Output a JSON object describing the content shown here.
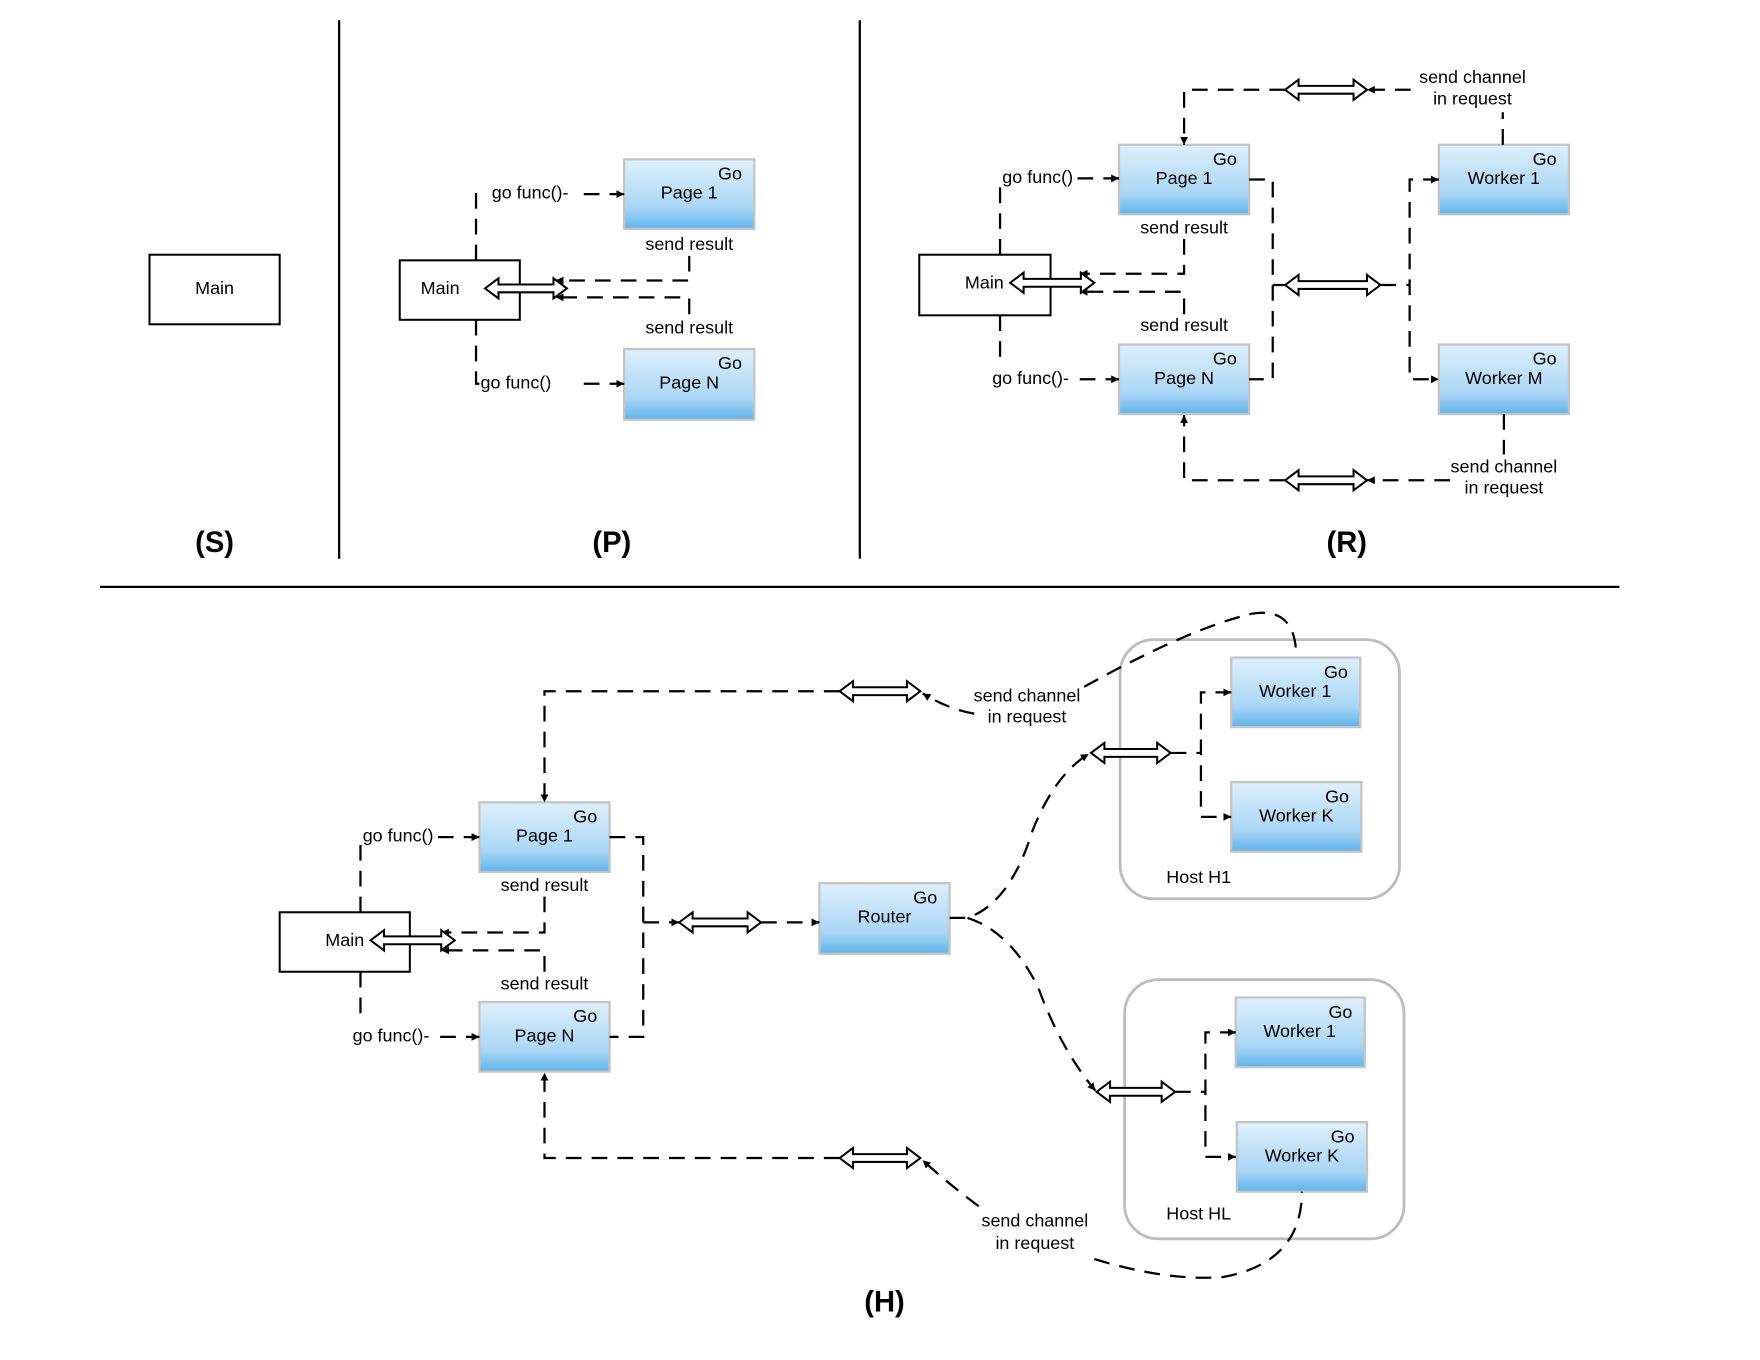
{
  "panels": {
    "S": {
      "label": "(S)",
      "main": "Main"
    },
    "P": {
      "label": "(P)",
      "main": "Main",
      "page1": "Page 1",
      "pageN": "Page N",
      "go": "Go",
      "go_func_top": "go func()-",
      "go_func_bottom": "go func()",
      "send_result": "send result"
    },
    "R": {
      "label": "(R)",
      "main": "Main",
      "page1": "Page 1",
      "pageN": "Page N",
      "worker1": "Worker 1",
      "workerM": "Worker M",
      "go": "Go",
      "go_func_top": "go func()",
      "go_func_bottom": "go func()-",
      "send_result": "send result",
      "send_channel_1": "send channel",
      "send_channel_2": "in request"
    },
    "H": {
      "label": "(H)",
      "main": "Main",
      "page1": "Page 1",
      "pageN": "Page N",
      "router": "Router",
      "go": "Go",
      "worker1": "Worker 1",
      "workerK": "Worker K",
      "host1": "Host H1",
      "hostL": "Host HL",
      "go_func_top": "go func()",
      "go_func_bottom": "go func()-",
      "send_result": "send result",
      "send_channel_1": "send channel",
      "send_channel_2": "in request"
    }
  },
  "colors": {
    "go_box_top": "#dff0fc",
    "go_box_bottom": "#5db4ea",
    "go_box_border": "#c4c4c4",
    "host_border": "#bdbdbd"
  }
}
